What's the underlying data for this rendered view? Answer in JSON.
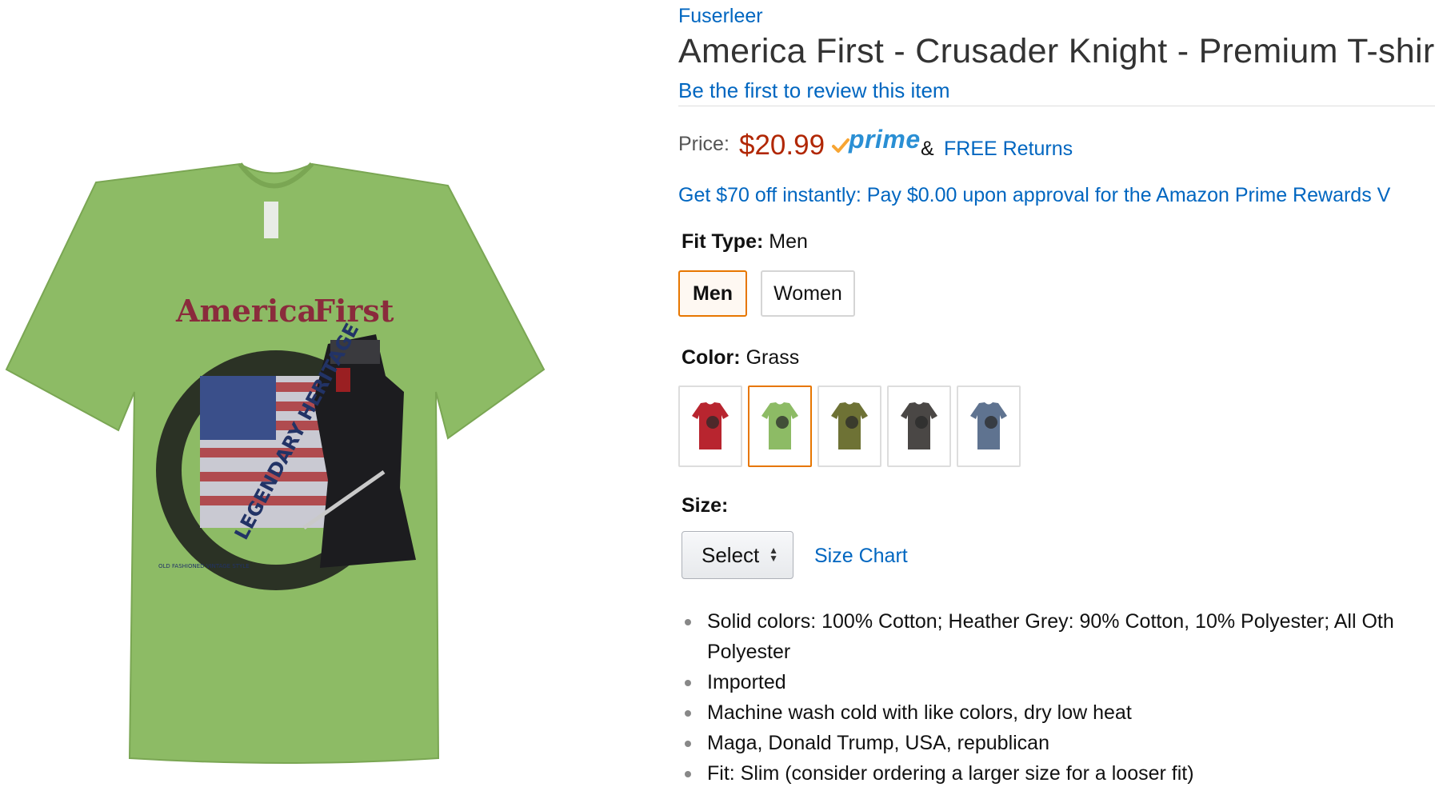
{
  "product_image": {
    "alt": "Grass t-shirt with America First crusader knight graphic",
    "graphic_text": {
      "headline": "America First",
      "arc": "LEGENDARY HERITAGE",
      "small": "OLD FASHIONED VINTAGE STYLE"
    },
    "shirt_color": "#8dbb65"
  },
  "product": {
    "brand": "Fuserleer",
    "title": "America First - Crusader Knight - Premium T-shirt",
    "review_link": "Be the first to review this item"
  },
  "price": {
    "label": "Price:",
    "value": "$20.99",
    "prime": "prime",
    "amp": "&",
    "free_returns": "FREE Returns"
  },
  "promo": "Get $70 off instantly: Pay $0.00 upon approval for the Amazon Prime Rewards V",
  "fit_type": {
    "label": "Fit Type:",
    "selected": "Men",
    "options": [
      "Men",
      "Women"
    ]
  },
  "color": {
    "label": "Color:",
    "selected": "Grass",
    "swatches": [
      {
        "name": "red-swatch",
        "color": "#b8252f"
      },
      {
        "name": "grass-swatch",
        "color": "#8dbb65"
      },
      {
        "name": "olive-swatch",
        "color": "#6e7235"
      },
      {
        "name": "charcoal-swatch",
        "color": "#4a4745"
      },
      {
        "name": "slate-swatch",
        "color": "#5f7390"
      }
    ]
  },
  "size": {
    "label": "Size:",
    "select": "Select",
    "chart_link": "Size Chart"
  },
  "bullets": [
    "Solid colors: 100% Cotton; Heather Grey: 90% Cotton, 10% Polyester; All Oth",
    "Polyester",
    "Imported",
    "Machine wash cold with like colors, dry low heat",
    "Maga, Donald Trump, USA, republican",
    "Fit: Slim (consider ordering a larger size for a looser fit)"
  ],
  "colors": {
    "link": "#0066c0",
    "price": "#b12704",
    "selected_border": "#e77600",
    "prime_blue": "#2a8fd4",
    "prime_check": "#f7a533"
  }
}
